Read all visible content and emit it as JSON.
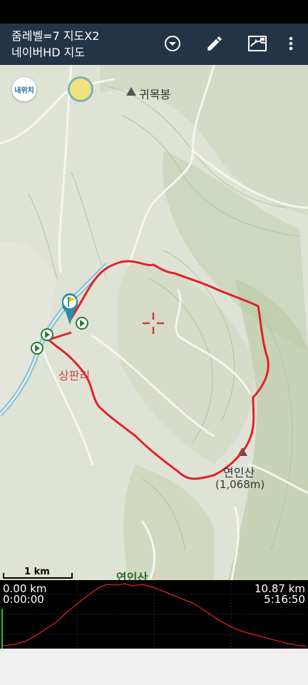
{
  "app": {
    "line1": "줌레벨=7 지도X2",
    "line2": "네이버HD 지도"
  },
  "icons": {
    "dropdown": "dropdown-circle-icon",
    "edit": "pencil-icon",
    "map_layers": "map-icon",
    "more": "more-vert-icon"
  },
  "map": {
    "my_location_label": "내위치",
    "labels": {
      "peak_north": "귀목봉",
      "village": "상판리",
      "peak_main": "연인산",
      "peak_main_height": "(1,068m)",
      "bottom_label": "연인산"
    },
    "scale_label": "1 km"
  },
  "elevation": {
    "distance_start": "0.00 km",
    "time_start": "0:00:00",
    "distance_end": "10.87 km",
    "time_end": "5:16:50"
  },
  "colors": {
    "track": "#e3202a",
    "appbar": "#243447",
    "map_bg": "#dde2d3"
  }
}
